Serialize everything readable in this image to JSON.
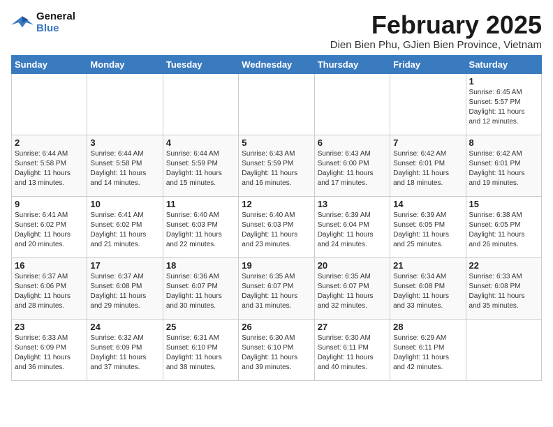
{
  "header": {
    "logo_line1": "General",
    "logo_line2": "Blue",
    "month_title": "February 2025",
    "location": "Dien Bien Phu, GJien Bien Province, Vietnam"
  },
  "weekdays": [
    "Sunday",
    "Monday",
    "Tuesday",
    "Wednesday",
    "Thursday",
    "Friday",
    "Saturday"
  ],
  "weeks": [
    [
      {
        "day": "",
        "info": ""
      },
      {
        "day": "",
        "info": ""
      },
      {
        "day": "",
        "info": ""
      },
      {
        "day": "",
        "info": ""
      },
      {
        "day": "",
        "info": ""
      },
      {
        "day": "",
        "info": ""
      },
      {
        "day": "1",
        "info": "Sunrise: 6:45 AM\nSunset: 5:57 PM\nDaylight: 11 hours\nand 12 minutes."
      }
    ],
    [
      {
        "day": "2",
        "info": "Sunrise: 6:44 AM\nSunset: 5:58 PM\nDaylight: 11 hours\nand 13 minutes."
      },
      {
        "day": "3",
        "info": "Sunrise: 6:44 AM\nSunset: 5:58 PM\nDaylight: 11 hours\nand 14 minutes."
      },
      {
        "day": "4",
        "info": "Sunrise: 6:44 AM\nSunset: 5:59 PM\nDaylight: 11 hours\nand 15 minutes."
      },
      {
        "day": "5",
        "info": "Sunrise: 6:43 AM\nSunset: 5:59 PM\nDaylight: 11 hours\nand 16 minutes."
      },
      {
        "day": "6",
        "info": "Sunrise: 6:43 AM\nSunset: 6:00 PM\nDaylight: 11 hours\nand 17 minutes."
      },
      {
        "day": "7",
        "info": "Sunrise: 6:42 AM\nSunset: 6:01 PM\nDaylight: 11 hours\nand 18 minutes."
      },
      {
        "day": "8",
        "info": "Sunrise: 6:42 AM\nSunset: 6:01 PM\nDaylight: 11 hours\nand 19 minutes."
      }
    ],
    [
      {
        "day": "9",
        "info": "Sunrise: 6:41 AM\nSunset: 6:02 PM\nDaylight: 11 hours\nand 20 minutes."
      },
      {
        "day": "10",
        "info": "Sunrise: 6:41 AM\nSunset: 6:02 PM\nDaylight: 11 hours\nand 21 minutes."
      },
      {
        "day": "11",
        "info": "Sunrise: 6:40 AM\nSunset: 6:03 PM\nDaylight: 11 hours\nand 22 minutes."
      },
      {
        "day": "12",
        "info": "Sunrise: 6:40 AM\nSunset: 6:03 PM\nDaylight: 11 hours\nand 23 minutes."
      },
      {
        "day": "13",
        "info": "Sunrise: 6:39 AM\nSunset: 6:04 PM\nDaylight: 11 hours\nand 24 minutes."
      },
      {
        "day": "14",
        "info": "Sunrise: 6:39 AM\nSunset: 6:05 PM\nDaylight: 11 hours\nand 25 minutes."
      },
      {
        "day": "15",
        "info": "Sunrise: 6:38 AM\nSunset: 6:05 PM\nDaylight: 11 hours\nand 26 minutes."
      }
    ],
    [
      {
        "day": "16",
        "info": "Sunrise: 6:37 AM\nSunset: 6:06 PM\nDaylight: 11 hours\nand 28 minutes."
      },
      {
        "day": "17",
        "info": "Sunrise: 6:37 AM\nSunset: 6:08 PM\nDaylight: 11 hours\nand 29 minutes."
      },
      {
        "day": "18",
        "info": "Sunrise: 6:36 AM\nSunset: 6:07 PM\nDaylight: 11 hours\nand 30 minutes."
      },
      {
        "day": "19",
        "info": "Sunrise: 6:35 AM\nSunset: 6:07 PM\nDaylight: 11 hours\nand 31 minutes."
      },
      {
        "day": "20",
        "info": "Sunrise: 6:35 AM\nSunset: 6:07 PM\nDaylight: 11 hours\nand 32 minutes."
      },
      {
        "day": "21",
        "info": "Sunrise: 6:34 AM\nSunset: 6:08 PM\nDaylight: 11 hours\nand 33 minutes."
      },
      {
        "day": "22",
        "info": "Sunrise: 6:33 AM\nSunset: 6:08 PM\nDaylight: 11 hours\nand 35 minutes."
      }
    ],
    [
      {
        "day": "23",
        "info": "Sunrise: 6:33 AM\nSunset: 6:09 PM\nDaylight: 11 hours\nand 36 minutes."
      },
      {
        "day": "24",
        "info": "Sunrise: 6:32 AM\nSunset: 6:09 PM\nDaylight: 11 hours\nand 37 minutes."
      },
      {
        "day": "25",
        "info": "Sunrise: 6:31 AM\nSunset: 6:10 PM\nDaylight: 11 hours\nand 38 minutes."
      },
      {
        "day": "26",
        "info": "Sunrise: 6:30 AM\nSunset: 6:10 PM\nDaylight: 11 hours\nand 39 minutes."
      },
      {
        "day": "27",
        "info": "Sunrise: 6:30 AM\nSunset: 6:11 PM\nDaylight: 11 hours\nand 40 minutes."
      },
      {
        "day": "28",
        "info": "Sunrise: 6:29 AM\nSunset: 6:11 PM\nDaylight: 11 hours\nand 42 minutes."
      },
      {
        "day": "",
        "info": ""
      }
    ]
  ]
}
